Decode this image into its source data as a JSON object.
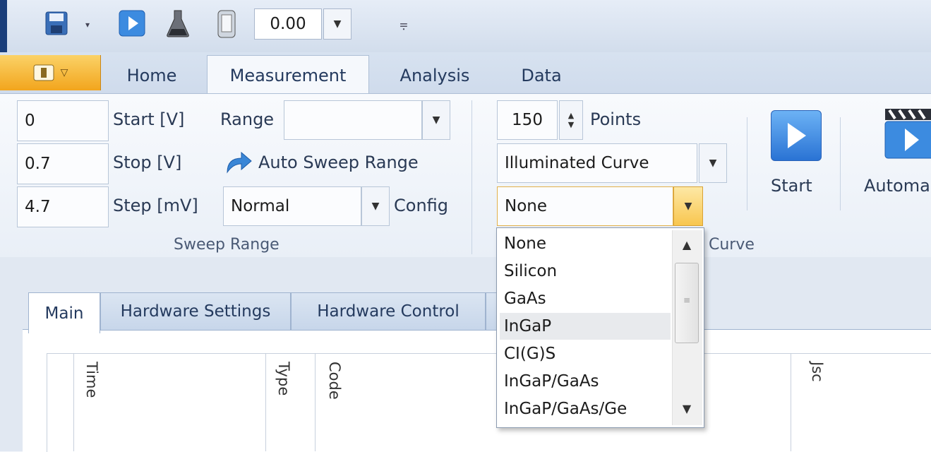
{
  "quick_access": {
    "zoom_value": "0.00",
    "customize_glyph": "⩦",
    "icons": [
      "app-logo-icon",
      "save-icon",
      "run-icon",
      "flask-icon",
      "device-icon"
    ]
  },
  "ribbon_tabs": [
    {
      "label": "Home",
      "active": false
    },
    {
      "label": "Measurement",
      "active": true
    },
    {
      "label": "Analysis",
      "active": false
    },
    {
      "label": "Data",
      "active": false
    }
  ],
  "sweep_range": {
    "start_value": "0",
    "start_label": "Start [V]",
    "stop_value": "0.7",
    "stop_label": "Stop [V]",
    "step_value": "4.7",
    "step_label": "Step [mV]",
    "range_label": "Range",
    "range_value": "",
    "auto_sweep_label": "Auto Sweep Range",
    "config_value": "Normal",
    "config_label": "Config",
    "group_label": "Sweep Range"
  },
  "curve": {
    "points_value": "150",
    "points_label": "Points",
    "curve_type": "Illuminated Curve",
    "cell_type": "None",
    "group_label_visible": "Curve"
  },
  "actions": {
    "start_label": "Start",
    "automation_label": "Automa"
  },
  "dropdown": {
    "items": [
      "None",
      "Silicon",
      "GaAs",
      "InGaP",
      "CI(G)S",
      "InGaP/GaAs",
      "InGaP/GaAs/Ge"
    ],
    "highlighted": "InGaP"
  },
  "work_tabs": [
    {
      "label": "Main",
      "active": true
    },
    {
      "label": "Hardware Settings",
      "active": false
    },
    {
      "label": "Hardware Control",
      "active": false
    }
  ],
  "columns": [
    "Time",
    "Type",
    "Code",
    "Jsc"
  ],
  "colors": {
    "accent_orange": "#f2a51d",
    "ribbon_blue": "#d7e2f0",
    "highlight": "#e8eaed"
  }
}
